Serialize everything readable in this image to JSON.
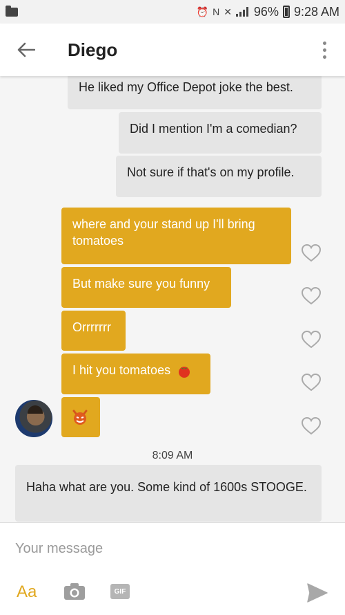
{
  "status_bar": {
    "battery": "96%",
    "time": "9:28 AM"
  },
  "header": {
    "title": "Diego"
  },
  "messages": [
    {
      "text": "He liked my Office Depot joke the best.",
      "side": "out",
      "style": "grey"
    },
    {
      "text": "Did I mention I'm a comedian?",
      "side": "out",
      "style": "grey"
    },
    {
      "text": "Not sure if that's on my profile.",
      "side": "out",
      "style": "grey"
    },
    {
      "text": "where and your stand up I'll bring tomatoes",
      "side": "out",
      "style": "gold"
    },
    {
      "text": "But make sure you funny",
      "side": "out",
      "style": "gold"
    },
    {
      "text": "Orrrrrrr",
      "side": "out",
      "style": "gold"
    },
    {
      "text": "I hit you tomatoes",
      "side": "out",
      "style": "gold",
      "emoji": "tomato-icon"
    },
    {
      "text": "",
      "side": "out",
      "style": "gold",
      "emoji": "devil-face-icon"
    }
  ],
  "timestamp": "8:09 AM",
  "incoming": {
    "text": "Haha what are you. Some kind of 1600s STOOGE."
  },
  "composer": {
    "placeholder": "Your message",
    "aa_label": "Aa",
    "gif_label": "GIF"
  },
  "colors": {
    "accent": "#e1a81f",
    "bubble_grey": "#e5e5e5",
    "chat_background": "#f5f5f5"
  }
}
